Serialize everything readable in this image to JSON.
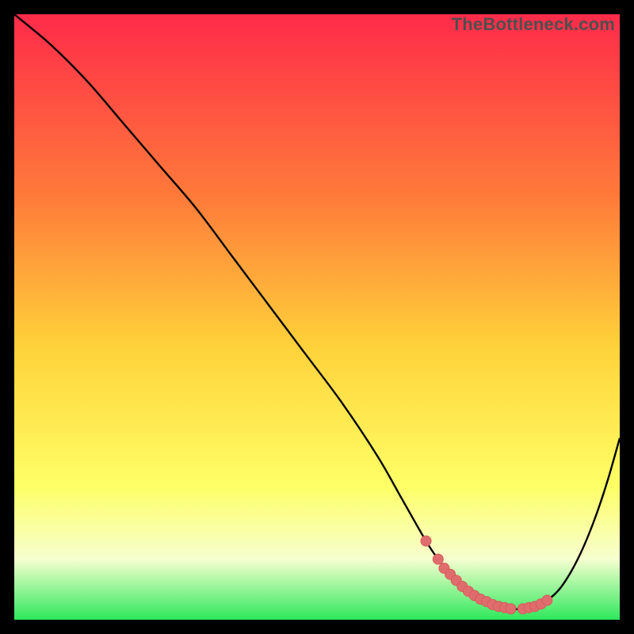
{
  "attribution": "TheBottleneck.com",
  "colors": {
    "frame": "#000000",
    "gradient_top": "#ff2b4a",
    "gradient_mid_upper": "#ff7a3a",
    "gradient_mid": "#ffd23a",
    "gradient_low_yellow": "#ffff66",
    "gradient_pale": "#f6ffcf",
    "gradient_green": "#2ee85c",
    "curve": "#000000",
    "marker_fill": "#e06d6d",
    "marker_stroke": "#d85a5a"
  },
  "chart_data": {
    "type": "line",
    "title": "",
    "xlabel": "",
    "ylabel": "",
    "xlim": [
      0,
      100
    ],
    "ylim": [
      0,
      100
    ],
    "series": [
      {
        "name": "bottleneck-curve",
        "x": [
          0,
          6,
          12,
          18,
          24,
          30,
          36,
          42,
          48,
          54,
          60,
          64,
          68,
          70,
          72,
          74,
          76,
          78,
          80,
          82,
          84,
          86,
          88,
          90,
          92,
          94,
          96,
          98,
          100
        ],
        "y": [
          100,
          95,
          89,
          82,
          75,
          68,
          60,
          52,
          44,
          36,
          27,
          20,
          13,
          10,
          7.5,
          5.5,
          4,
          3,
          2.2,
          1.8,
          1.8,
          2.2,
          3.2,
          5,
          8,
          12,
          17,
          23,
          30
        ]
      }
    ],
    "markers": {
      "name": "optimal-range",
      "x": [
        68,
        70,
        71,
        72,
        73,
        74,
        75,
        76,
        77,
        78,
        79,
        80,
        81,
        82,
        84,
        85,
        86,
        87,
        88
      ],
      "y": [
        13,
        10,
        8.5,
        7.5,
        6.5,
        5.5,
        4.7,
        4,
        3.4,
        3,
        2.5,
        2.2,
        2,
        1.8,
        1.8,
        2,
        2.2,
        2.6,
        3.2
      ]
    },
    "gradient_stops": [
      {
        "offset": 0.0,
        "key": "gradient_top"
      },
      {
        "offset": 0.3,
        "key": "gradient_mid_upper"
      },
      {
        "offset": 0.55,
        "key": "gradient_mid"
      },
      {
        "offset": 0.78,
        "key": "gradient_low_yellow"
      },
      {
        "offset": 0.9,
        "key": "gradient_pale"
      },
      {
        "offset": 1.0,
        "key": "gradient_green"
      }
    ]
  }
}
